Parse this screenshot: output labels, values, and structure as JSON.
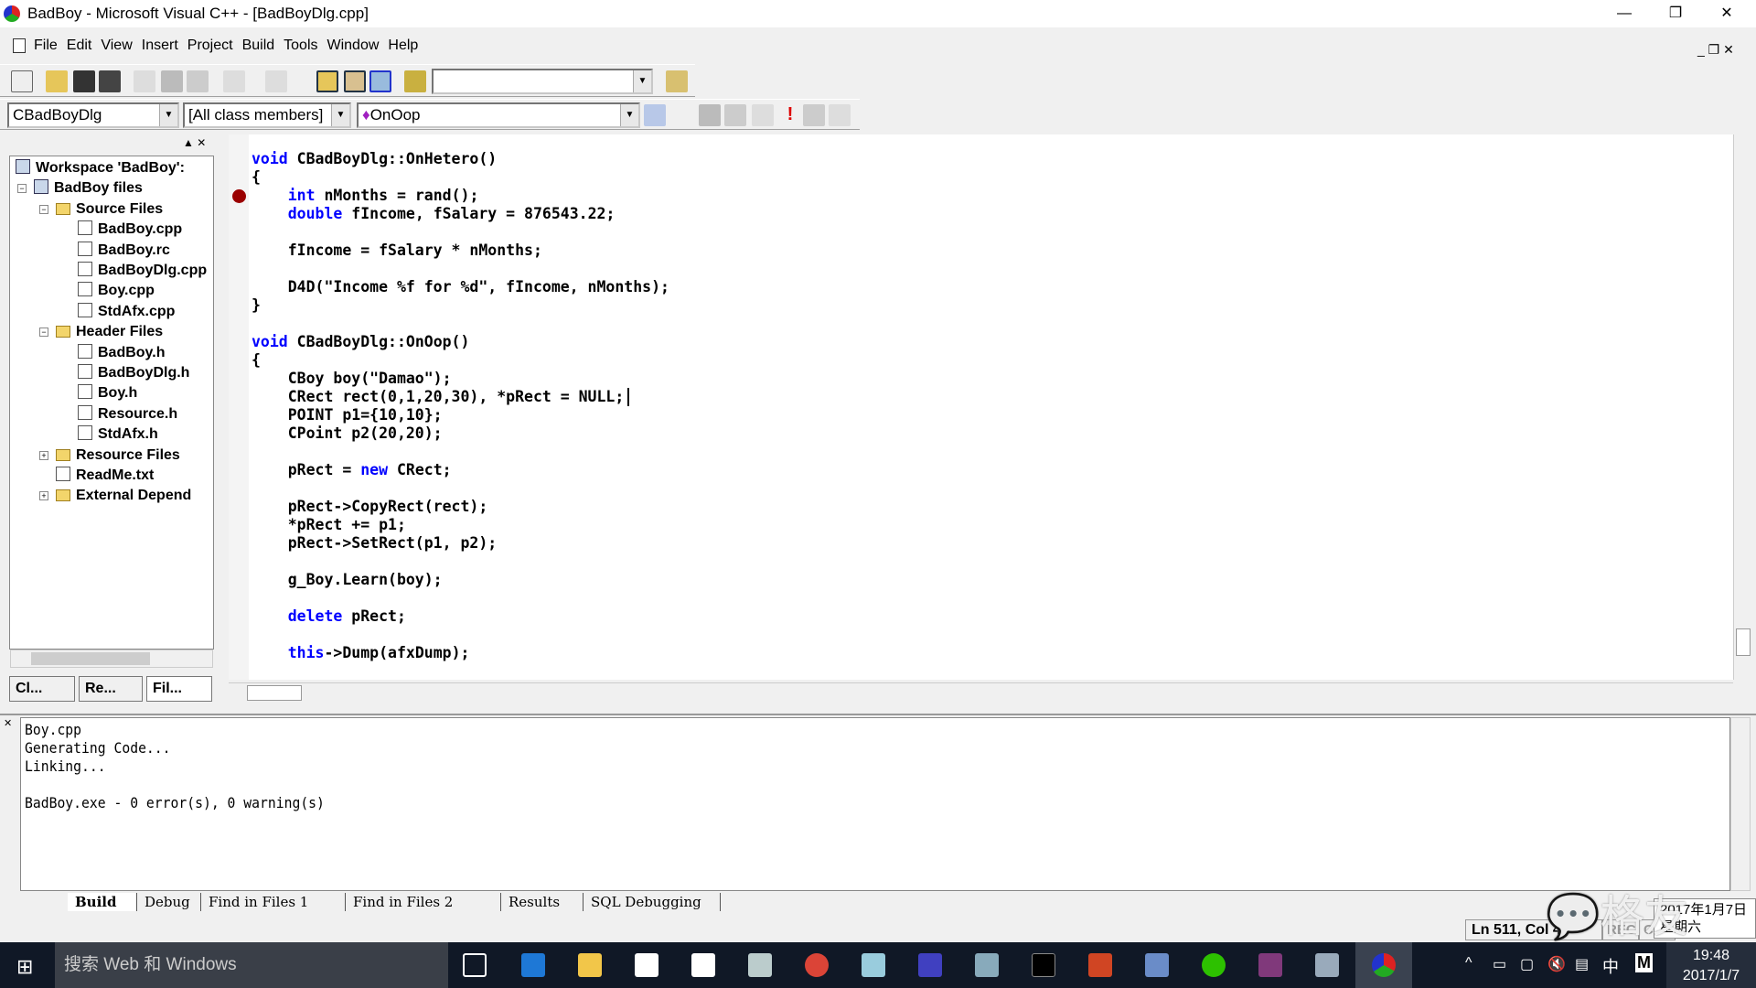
{
  "window": {
    "title": "BadBoy - Microsoft Visual C++ - [BadBoyDlg.cpp]",
    "minimize": "—",
    "restore": "❐",
    "close": "✕"
  },
  "menu": [
    "File",
    "Edit",
    "View",
    "Insert",
    "Project",
    "Build",
    "Tools",
    "Window",
    "Help"
  ],
  "toolbar": {
    "find_value": "",
    "class_combo": "CBadBoyDlg",
    "filter_combo": "[All class members]",
    "member_combo": "OnOop"
  },
  "workspace": {
    "tree": [
      {
        "label": "Workspace 'BadBoy':",
        "level": 0,
        "icon": "workspace-icon"
      },
      {
        "label": "BadBoy files",
        "level": 1,
        "icon": "project-icon",
        "exp": "−"
      },
      {
        "label": "Source Files",
        "level": 2,
        "icon": "folder-open-icon",
        "exp": "−"
      },
      {
        "label": "BadBoy.cpp",
        "level": 3,
        "icon": "cpp-file-icon"
      },
      {
        "label": "BadBoy.rc",
        "level": 3,
        "icon": "cpp-file-icon"
      },
      {
        "label": "BadBoyDlg.cpp",
        "level": 3,
        "icon": "cpp-file-icon"
      },
      {
        "label": "Boy.cpp",
        "level": 3,
        "icon": "cpp-file-icon"
      },
      {
        "label": "StdAfx.cpp",
        "level": 3,
        "icon": "cpp-file-icon"
      },
      {
        "label": "Header Files",
        "level": 2,
        "icon": "folder-open-icon",
        "exp": "−"
      },
      {
        "label": "BadBoy.h",
        "level": 3,
        "icon": "header-file-icon"
      },
      {
        "label": "BadBoyDlg.h",
        "level": 3,
        "icon": "header-file-icon"
      },
      {
        "label": "Boy.h",
        "level": 3,
        "icon": "header-file-icon"
      },
      {
        "label": "Resource.h",
        "level": 3,
        "icon": "header-file-icon"
      },
      {
        "label": "StdAfx.h",
        "level": 3,
        "icon": "header-file-icon"
      },
      {
        "label": "Resource Files",
        "level": 2,
        "icon": "folder-icon",
        "exp": "+"
      },
      {
        "label": "ReadMe.txt",
        "level": 2,
        "icon": "text-file-icon"
      },
      {
        "label": "External Depend",
        "level": 2,
        "icon": "folder-icon",
        "exp": "+"
      }
    ],
    "tabs": [
      "Cl...",
      "Re...",
      "Fil..."
    ]
  },
  "editor": {
    "breakpoint_line": 2,
    "lines": [
      "void CBadBoyDlg::OnHetero()",
      "{",
      "    int nMonths = rand();",
      "    double fIncome, fSalary = 876543.22;",
      "",
      "    fIncome = fSalary * nMonths;",
      "",
      "    D4D(\"Income %f for %d\", fIncome, nMonths);",
      "}",
      "",
      "void CBadBoyDlg::OnOop()",
      "{",
      "    CBoy boy(\"Damao\");",
      "    CRect rect(0,1,20,30), *pRect = NULL;",
      "    POINT p1={10,10};",
      "    CPoint p2(20,20);",
      "",
      "    pRect = new CRect;",
      "",
      "    pRect->CopyRect(rect);",
      "    *pRect += p1;",
      "    pRect->SetRect(p1, p2);",
      "",
      "    g_Boy.Learn(boy);",
      "",
      "    delete pRect;",
      "",
      "    this->Dump(afxDump);"
    ],
    "keywords": [
      "void",
      "int",
      "double",
      "new",
      "delete",
      "this"
    ],
    "keyword_color": "#0000ff"
  },
  "output": {
    "lines": [
      "Boy.cpp",
      "Generating Code...",
      "Linking...",
      "",
      "BadBoy.exe - 0 error(s), 0 warning(s)"
    ],
    "tabs": [
      "Build",
      "Debug",
      "Find in Files 1",
      "Find in Files 2",
      "Results",
      "SQL Debugging"
    ],
    "active_tab": "Build"
  },
  "status": {
    "position": "Ln 511, Col 42",
    "rec": "REC",
    "col": "COL"
  },
  "taskbar": {
    "search_placeholder": "搜索 Web 和 Windows",
    "time": "19:48",
    "date": "2017/1/7",
    "ime": "中",
    "ime2": "M",
    "tooltip_date": "2017年1月7日",
    "tooltip_day": "星期六"
  },
  "watermark": "格友"
}
